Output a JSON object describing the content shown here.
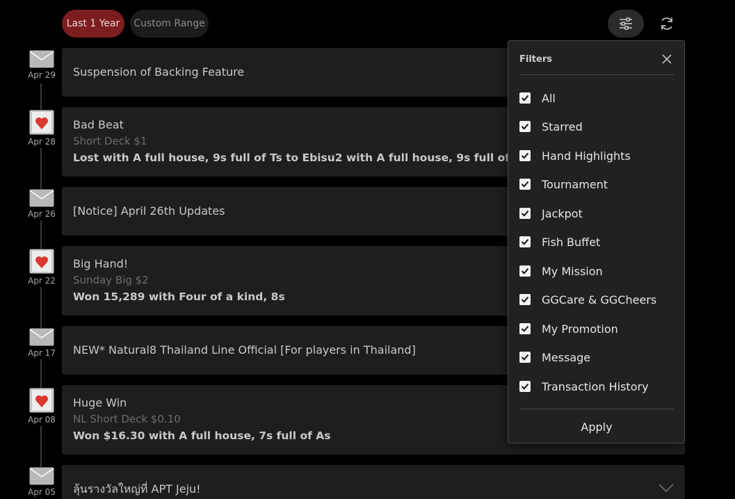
{
  "range_buttons": {
    "last_year": "Last 1 Year",
    "custom": "Custom Range"
  },
  "toolbar": {
    "filter_icon": "sliders-icon",
    "refresh_icon": "refresh-icon"
  },
  "colors": {
    "accent": "#7c1d1f",
    "background": "#000000",
    "card": "#1e1e1e",
    "panel": "#212121",
    "heart": "#d9382e"
  },
  "timeline": [
    {
      "date": "Apr 29",
      "icon": "envelope-icon",
      "title": "Suspension of Backing Feature"
    },
    {
      "date": "Apr 28",
      "icon": "heart-card-icon",
      "title": "Bad Beat",
      "subtitle": "Short Deck $1",
      "detail": "Lost with A full house, 9s full of Ts to Ebisu2 with A full house, 9s full of Ks"
    },
    {
      "date": "Apr 26",
      "icon": "envelope-icon",
      "title": "[Notice] April 26th Updates"
    },
    {
      "date": "Apr 22",
      "icon": "heart-card-icon",
      "title": "Big Hand!",
      "subtitle": "Sunday Big $2",
      "detail": "Won 15,289 with Four of a kind, 8s"
    },
    {
      "date": "Apr 17",
      "icon": "envelope-icon",
      "title": "NEW* Natural8 Thailand Line Official [For players in Thailand]"
    },
    {
      "date": "Apr 08",
      "icon": "heart-card-icon",
      "title": "Huge Win",
      "subtitle": "NL Short Deck $0.10",
      "detail": "Won $16.30 with A full house, 7s full of As"
    },
    {
      "date": "Apr 05",
      "icon": "envelope-icon",
      "title": "ลุ้นรางวัลใหญ่ที่ APT Jeju!"
    }
  ],
  "filters": {
    "title": "Filters",
    "close_icon": "close-icon",
    "items": [
      {
        "label": "All",
        "checked": true
      },
      {
        "label": "Starred",
        "checked": true
      },
      {
        "label": "Hand Highlights",
        "checked": true
      },
      {
        "label": "Tournament",
        "checked": true
      },
      {
        "label": "Jackpot",
        "checked": true
      },
      {
        "label": "Fish Buffet",
        "checked": true
      },
      {
        "label": "My Mission",
        "checked": true
      },
      {
        "label": "GGCare & GGCheers",
        "checked": true
      },
      {
        "label": "My Promotion",
        "checked": true
      },
      {
        "label": "Message",
        "checked": true
      },
      {
        "label": "Transaction History",
        "checked": true
      }
    ],
    "apply_label": "Apply"
  }
}
